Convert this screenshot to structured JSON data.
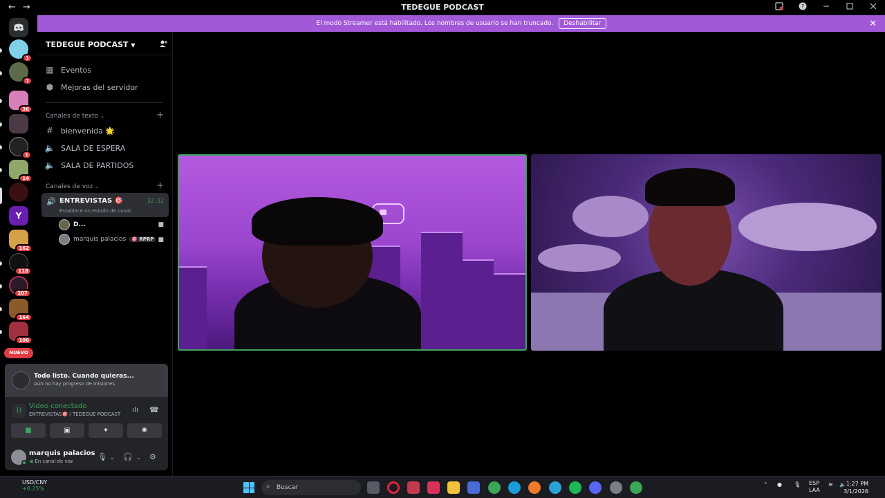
{
  "titlebar": {
    "title": "TEDEGUE PODCAST",
    "back": "←",
    "forward": "→"
  },
  "banner": {
    "text": "El modo Streamer está habilitado. Los nombres de usuario se han truncado.",
    "button": "Deshabilitar"
  },
  "servers": {
    "badges": [
      "1",
      "1",
      "36",
      "1",
      "14",
      "162",
      "118",
      "207",
      "164",
      "106"
    ],
    "nuevo": "NUEVO"
  },
  "sidebar": {
    "server_name": "TEDEGUE PODCAST",
    "events": "Eventos",
    "boosts": "Mejoras del servidor",
    "text_category": "Canales de texto",
    "text_channels": [
      "bienvenida 🌟",
      "SALA DE ESPERA",
      "SALA DE PARTIDOS"
    ],
    "voice_category": "Canales de voz",
    "voice_channel": "ENTREVISTAS 🎯",
    "voice_timer": "32:12",
    "voice_status": "Establece un estado de canal",
    "voice_users": [
      {
        "name": "D...",
        "tag": ""
      },
      {
        "name": "marquis palacios",
        "tag": "🎯 RPRP"
      }
    ]
  },
  "quest": {
    "title": "Todo listo. Cuando quieras...",
    "subtitle": "Aún no hay progreso de misiones"
  },
  "voice_panel": {
    "status": "Video conectado",
    "channel": "ENTREVISTAS🎯 / TEDEGUE PODCAST"
  },
  "user": {
    "name": "marquis palacios",
    "status": "En canal de voz"
  },
  "taskbar": {
    "widget_label": "USD/CNY",
    "widget_value": "+0.25%",
    "search_placeholder": "Buscar",
    "lang1": "ESP",
    "lang2": "LAA",
    "time": "1:27 PM",
    "date": "3/1/2026"
  },
  "colors": {
    "accent": "#a259d8",
    "green": "#3ba55d",
    "red": "#e03e44"
  }
}
